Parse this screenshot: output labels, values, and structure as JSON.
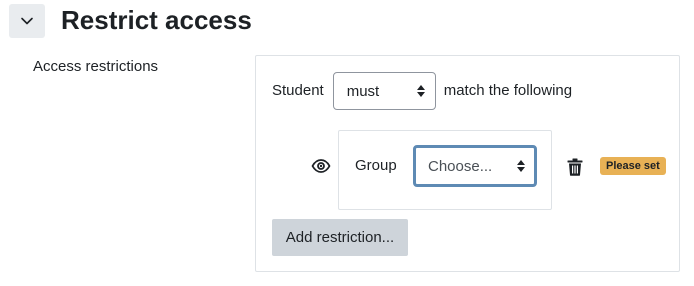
{
  "section": {
    "title": "Restrict access",
    "collapse_icon": "chevron-down-icon"
  },
  "field": {
    "label": "Access restrictions"
  },
  "restrictions": {
    "prefix": "Student",
    "match_select": {
      "selected": "must"
    },
    "suffix": "match the following",
    "condition": {
      "visibility_icon": "eye-icon",
      "type_label": "Group",
      "group_select": {
        "selected": "Choose..."
      },
      "delete_icon": "trash-icon",
      "status_badge": "Please set"
    },
    "add_button_label": "Add restriction..."
  },
  "colors": {
    "accent_focus": "#5e8ab4",
    "badge_warning": "#e8b155",
    "button_secondary": "#ced4da",
    "collapse_bg": "#e9ecef"
  }
}
